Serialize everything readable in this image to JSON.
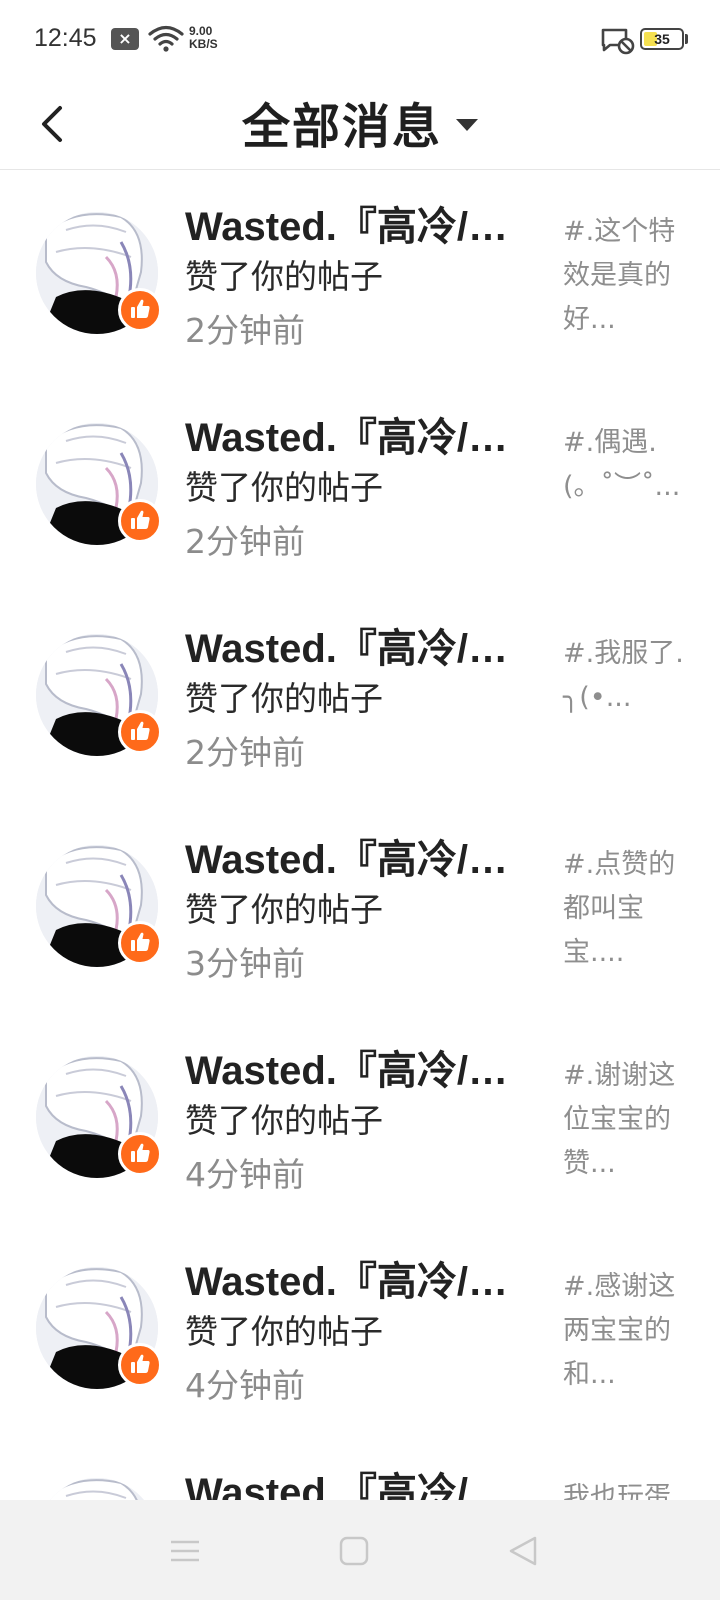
{
  "status_bar": {
    "time": "12:45",
    "network_speed_value": "9.00",
    "network_speed_unit": "KB/S",
    "battery_level": "35",
    "battery_fraction": 0.35
  },
  "header": {
    "title": "全部消息"
  },
  "messages": [
    {
      "name": "Wasted.『高冷/…",
      "action": "赞了你的帖子",
      "time": "2分钟前",
      "preview": "#.这个特效是真的好..."
    },
    {
      "name": "Wasted.『高冷/…",
      "action": "赞了你的帖子",
      "time": "2分钟前",
      "preview": "#.偶遇.(。˚︶˚..."
    },
    {
      "name": "Wasted.『高冷/…",
      "action": "赞了你的帖子",
      "time": "2分钟前",
      "preview": "#.我服了.╮(•..."
    },
    {
      "name": "Wasted.『高冷/…",
      "action": "赞了你的帖子",
      "time": "3分钟前",
      "preview": "#.点赞的都叫宝宝...."
    },
    {
      "name": "Wasted.『高冷/…",
      "action": "赞了你的帖子",
      "time": "4分钟前",
      "preview": "#.谢谢这位宝宝的赞..."
    },
    {
      "name": "Wasted.『高冷/…",
      "action": "赞了你的帖子",
      "time": "4分钟前",
      "preview": "#.感谢这两宝宝的和..."
    },
    {
      "name": "Wasted.『高冷/…",
      "action": "",
      "time": "",
      "preview": "我也玩蛋"
    }
  ],
  "colors": {
    "like_badge": "#ff6a1a",
    "secondary_text": "#8c8c8c",
    "nav_bar_bg": "#f2f2f2"
  },
  "icons": {
    "back": "chevron-left-icon",
    "dropdown": "caret-down-icon",
    "like": "thumbs-up-icon",
    "nav_menu": "menu-icon",
    "nav_home": "square-icon",
    "nav_back": "triangle-back-icon"
  }
}
